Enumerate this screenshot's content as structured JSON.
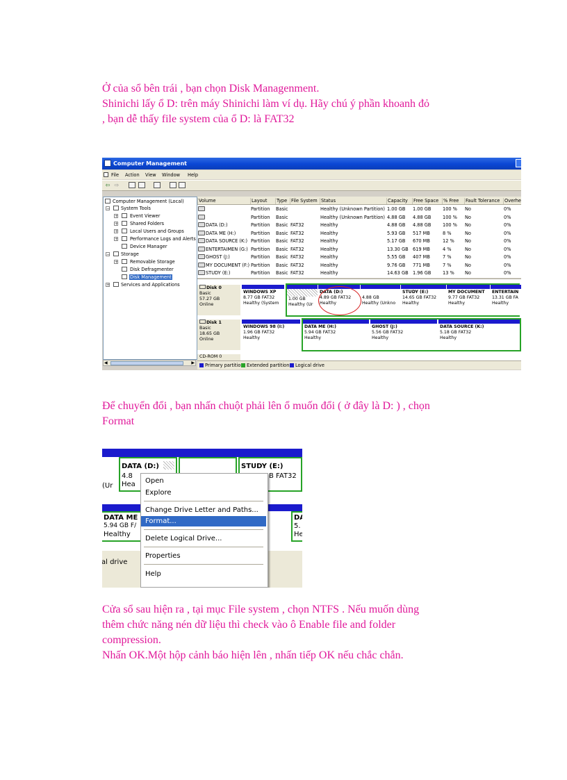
{
  "paragraphs": {
    "p1": [
      "Ở của sổ bên trái , bạn chọn Disk Managenment.",
      "Shinichi lấy ổ D: trên máy Shinichi làm ví dụ. Hãy chú ý phần khoanh đỏ",
      ", bạn dễ thấy file system của ổ D: là FAT32"
    ],
    "p2": [
      "Để chuyển đổi , bạn nhấn chuột phải lên ổ muốn đổi ( ở đây là D: ) , chọn",
      "Format"
    ],
    "p3": [
      "Cửa sổ sau hiện ra , tại mục File system , chọn NTFS . Nếu muốn dùng",
      "thêm chức năng nén dữ liệu thì check vào ô Enable file and folder",
      "compression.",
      "Nhấn OK.Một hộp cảnh báo hiện lên , nhấn tiếp OK nếu chắc chắn."
    ]
  },
  "computer_management": {
    "title": "Computer Management",
    "menu": [
      "File",
      "Action",
      "View",
      "Window",
      "Help"
    ],
    "tree": {
      "root": "Computer Management (Local)",
      "system_tools": "System Tools",
      "event_viewer": "Event Viewer",
      "shared_folders": "Shared Folders",
      "local_users": "Local Users and Groups",
      "perf_logs": "Performance Logs and Alerts",
      "device_manager": "Device Manager",
      "storage": "Storage",
      "removable_storage": "Removable Storage",
      "disk_defrag": "Disk Defragmenter",
      "disk_management": "Disk Management",
      "services": "Services and Applications"
    },
    "columns": [
      "Volume",
      "Layout",
      "Type",
      "File System",
      "Status",
      "Capacity",
      "Free Space",
      "% Free",
      "Fault Tolerance",
      "Overhe"
    ],
    "rows": [
      [
        "",
        "Partition",
        "Basic",
        "",
        "Healthy (Unknown Partition)",
        "1.00 GB",
        "1.00 GB",
        "100 %",
        "No",
        "0%"
      ],
      [
        "",
        "Partition",
        "Basic",
        "",
        "Healthy (Unknown Partition)",
        "4.88 GB",
        "4.88 GB",
        "100 %",
        "No",
        "0%"
      ],
      [
        "DATA (D:)",
        "Partition",
        "Basic",
        "FAT32",
        "Healthy",
        "4.88 GB",
        "4.88 GB",
        "100 %",
        "No",
        "0%"
      ],
      [
        "DATA ME (H:)",
        "Partition",
        "Basic",
        "FAT32",
        "Healthy",
        "5.93 GB",
        "517 MB",
        "8 %",
        "No",
        "0%"
      ],
      [
        "DATA SOURCE (K:)",
        "Partition",
        "Basic",
        "FAT32",
        "Healthy",
        "5.17 GB",
        "670 MB",
        "12 %",
        "No",
        "0%"
      ],
      [
        "ENTERTAIMEN (G:)",
        "Partition",
        "Basic",
        "FAT32",
        "Healthy",
        "13.30 GB",
        "619 MB",
        "4 %",
        "No",
        "0%"
      ],
      [
        "GHOST (J:)",
        "Partition",
        "Basic",
        "FAT32",
        "Healthy",
        "5.55 GB",
        "407 MB",
        "7 %",
        "No",
        "0%"
      ],
      [
        "MY DOCUMENT (F:)",
        "Partition",
        "Basic",
        "FAT32",
        "Healthy",
        "9.76 GB",
        "771 MB",
        "7 %",
        "No",
        "0%"
      ],
      [
        "STUDY (E:)",
        "Partition",
        "Basic",
        "FAT32",
        "Healthy",
        "14.63 GB",
        "1.96 GB",
        "13 %",
        "No",
        "0%"
      ]
    ],
    "disk0": {
      "name": "Disk 0",
      "type": "Basic",
      "size": "57.27 GB",
      "status": "Online",
      "parts": [
        {
          "name": "WINDOWS XP",
          "size": "8.77 GB FAT32",
          "status": "Healthy (System"
        },
        {
          "name": "",
          "size": "1.00 GB",
          "status": "Healthy (Ur"
        },
        {
          "name": "DATA  (D:)",
          "size": "4.89 GB FAT32",
          "status": "Healthy"
        },
        {
          "name": "",
          "size": "4.88 GB",
          "status": "Healthy (Unkno"
        },
        {
          "name": "STUDY  (E:)",
          "size": "14.65 GB FAT32",
          "status": "Healthy"
        },
        {
          "name": "MY DOCUMENT",
          "size": "9.77 GB FAT32",
          "status": "Healthy"
        },
        {
          "name": "ENTERTAIN",
          "size": "13.31 GB FA",
          "status": "Healthy"
        }
      ]
    },
    "disk1": {
      "name": "Disk 1",
      "type": "Basic",
      "size": "18.65 GB",
      "status": "Online",
      "parts": [
        {
          "name": "WINDOWS 98  (I:)",
          "size": "1.96 GB FAT32",
          "status": "Healthy"
        },
        {
          "name": "DATA ME  (H:)",
          "size": "5.94 GB FAT32",
          "status": "Healthy"
        },
        {
          "name": "GHOST  (J:)",
          "size": "5.56 GB FAT32",
          "status": "Healthy"
        },
        {
          "name": "DATA SOURCE  (K:)",
          "size": "5.18 GB FAT32",
          "status": "Healthy"
        }
      ]
    },
    "cdrom": "CD-ROM 0",
    "legend": [
      "Primary partition",
      "Extended partition",
      "Logical drive"
    ],
    "colors": {
      "primary": "#1b1bcd",
      "extended": "#27a327",
      "logical": "#1b1bcd",
      "highlight": "#d62020"
    }
  },
  "context_shot": {
    "cells": {
      "data_name": "DATA  (D:)",
      "data_size": "4.8",
      "data_status": "Hea",
      "ur": "(Ur",
      "study_name": "STUDY  (E:)",
      "study_size": "B FAT32",
      "data_me": "DATA ME",
      "data_me_size": "5.94 GB F/",
      "data_me_status": "Healthy",
      "da": "DA",
      "da2": "5.",
      "da3": "He",
      "legend_frag": "al drive"
    },
    "menu": [
      "Open",
      "Explore",
      "Change Drive Letter and Paths...",
      "Format...",
      "Delete Logical Drive...",
      "Properties",
      "Help"
    ]
  }
}
